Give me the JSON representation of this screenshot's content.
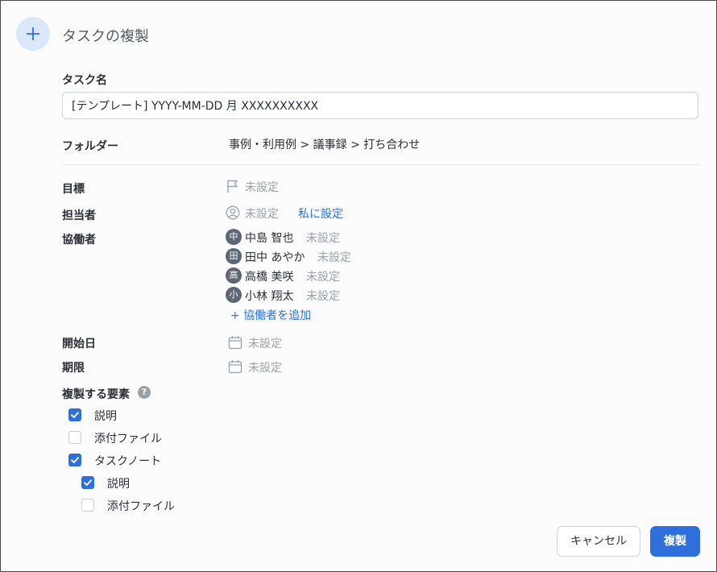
{
  "dialog": {
    "title": "タスクの複製"
  },
  "task_name": {
    "label": "タスク名",
    "value": "[テンプレート] YYYY-MM-DD 月 XXXXXXXXXX"
  },
  "folder": {
    "label": "フォルダー",
    "path": "事例・利用例 >  議事録 > 打ち合わせ"
  },
  "goal": {
    "label": "目標",
    "value": "未設定",
    "icon": "flag-icon"
  },
  "assignee": {
    "label": "担当者",
    "value": "未設定",
    "icon": "person-circle-icon",
    "assign_me": "私に設定"
  },
  "collaborators": {
    "label": "協働者",
    "items": [
      {
        "initial": "中",
        "name": "中島 智也",
        "status": "未設定"
      },
      {
        "initial": "田",
        "name": "田中 あやか",
        "status": "未設定"
      },
      {
        "initial": "高",
        "name": "高橋 美咲",
        "status": "未設定"
      },
      {
        "initial": "小",
        "name": "小林 翔太",
        "status": "未設定"
      }
    ],
    "add_label": "+ 協働者を追加"
  },
  "start_date": {
    "label": "開始日",
    "value": "未設定",
    "icon": "calendar-icon"
  },
  "due_date": {
    "label": "期限",
    "value": "未設定",
    "icon": "calendar-icon"
  },
  "copy_elements": {
    "label": "複製する要素",
    "help": "?",
    "options": [
      {
        "label": "説明",
        "checked": true
      },
      {
        "label": "添付ファイル",
        "checked": false
      },
      {
        "label": "タスクノート",
        "checked": true
      },
      {
        "label": "説明",
        "checked": true
      },
      {
        "label": "添付ファイル",
        "checked": false
      }
    ]
  },
  "buttons": {
    "cancel": "キャンセル",
    "copy": "複製"
  },
  "colors": {
    "accent": "#2f6fdc",
    "muted": "#9aa1ab",
    "avatar": "#5d6673"
  }
}
